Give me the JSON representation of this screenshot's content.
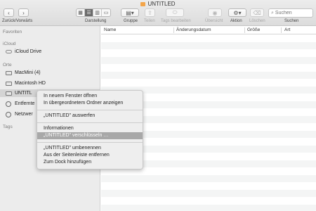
{
  "window": {
    "title": "UNTITLED"
  },
  "toolbar": {
    "nav_label": "Zurück/Vorwärts",
    "view_label": "Darstellung",
    "group_label": "Gruppe",
    "share_label": "Teilen",
    "tags_label": "Tags bearbeiten",
    "quicklook_label": "Übersicht",
    "action_label": "Aktion",
    "delete_label": "Löschen",
    "search_label": "Suchen",
    "search_placeholder": "Suchen"
  },
  "sidebar": {
    "favorites_header": "Favoriten",
    "icloud_header": "iCloud",
    "icloud_drive": "iCloud Drive",
    "locations_header": "Orte",
    "macmini": "MacMini (4)",
    "macintosh_hd": "Macintosh HD",
    "untitled": "UNTITL",
    "remote": "Entfernte",
    "network": "Netzwer",
    "tags_header": "Tags"
  },
  "columns": {
    "name": "Name",
    "modified": "Änderungsdatum",
    "size": "Größe",
    "kind": "Art"
  },
  "context_menu": {
    "open_new_window": "In neuem Fenster öffnen",
    "show_enclosing": "In übergeordnetem Ordner anzeigen",
    "eject": "„UNTITLED\" auswerfen",
    "get_info": "Informationen",
    "encrypt": "„UNTITLED\" verschlüsseln …",
    "rename": "„UNTITLED\" umbenennen",
    "remove_sidebar": "Aus der Seitenleiste entfernen",
    "add_dock": "Zum Dock hinzufügen"
  }
}
